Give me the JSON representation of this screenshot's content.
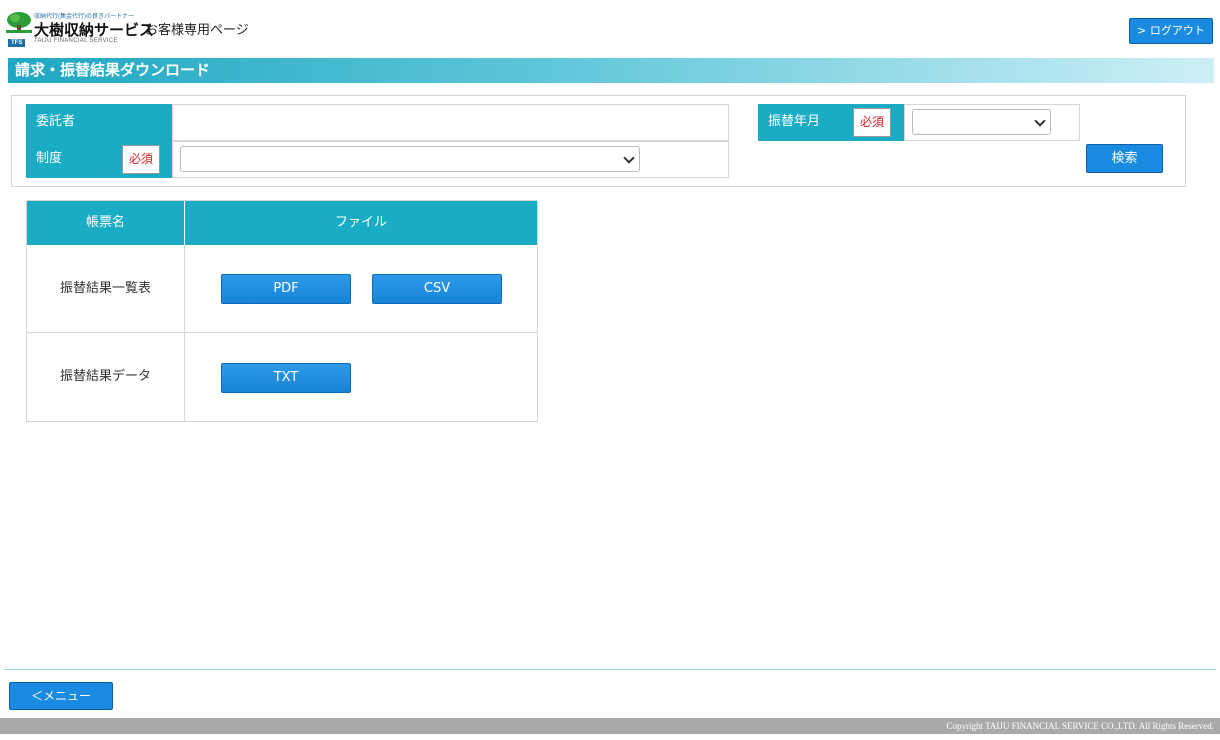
{
  "header": {
    "logo_tagline": "収納代行(集金代行)の良きパートナー",
    "logo_name": "大樹収納サービス",
    "logo_abbr": "TFS",
    "logo_en": "TAIJU FINANCIAL SERVICE",
    "page_label": "お客様専用ページ",
    "logout_label": "> ログアウト"
  },
  "title": "請求・振替結果ダウンロード",
  "search": {
    "consignor_label": "委託者",
    "consignor_value": "",
    "system_label": "制度",
    "required_badge": "必須",
    "system_value": "",
    "month_label": "振替年月",
    "month_value": "",
    "search_label": "検索"
  },
  "table": {
    "headers": [
      "帳票名",
      "ファイル"
    ],
    "rows": [
      {
        "name": "振替結果一覧表",
        "buttons": [
          "PDF",
          "CSV"
        ]
      },
      {
        "name": "振替結果データ",
        "buttons": [
          "TXT"
        ]
      }
    ]
  },
  "footer": {
    "menu_label": "＜メニュー",
    "copyright": "Copyright TAIJU FINANCIAL SERVICE CO.,LTD. All Rights Reserved."
  },
  "colors": {
    "accent": "#1aacc4",
    "button": "#1a8be0",
    "required_text": "#e02020"
  }
}
